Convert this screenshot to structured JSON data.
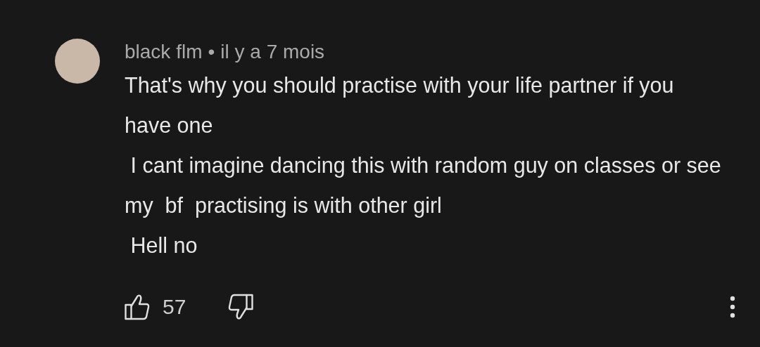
{
  "comment": {
    "author": "black flm",
    "separator": "•",
    "time": "il y a 7 mois",
    "text": "That's why you should practise with your life partner if you have one\n I cant imagine dancing this with random guy on classes or see my  bf  practising is with other girl\n Hell no",
    "likes": "57"
  }
}
